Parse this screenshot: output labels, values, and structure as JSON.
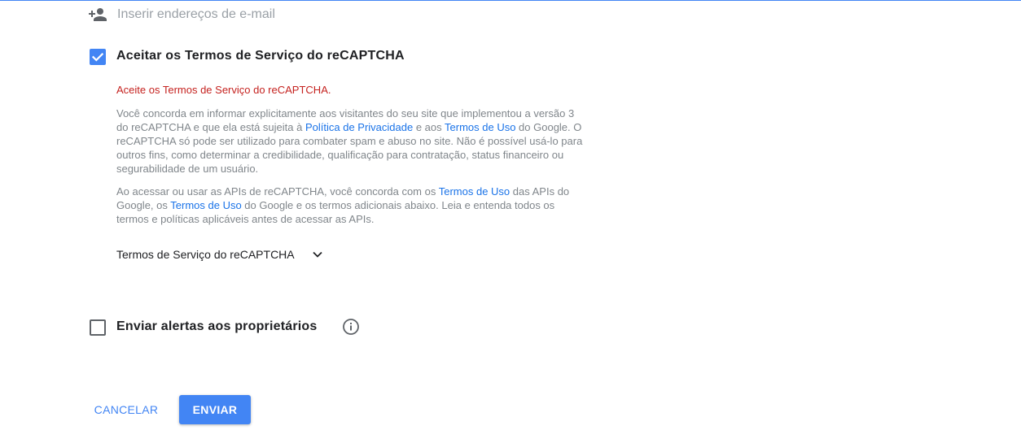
{
  "email": {
    "placeholder": "Inserir endereços de e-mail",
    "icon": "person-add-icon"
  },
  "accept_tos": {
    "label": "Aceitar os Termos de Serviço do reCAPTCHA",
    "checked": true,
    "error": "Aceite os Termos de Serviço do reCAPTCHA.",
    "paragraph1": {
      "t1": "Você concorda em informar explicitamente aos visitantes do seu site que implementou a versão 3 do reCAPTCHA e que ela está sujeita à ",
      "link_privacy": "Política de Privacidade",
      "t2": " e aos ",
      "link_terms": "Termos de Uso",
      "t3": " do Google. O reCAPTCHA só pode ser utilizado para combater spam e abuso no site. Não é possível usá-lo para outros fins, como determinar a credibilidade, qualificação para contratação, status financeiro ou segurabilidade de um usuário."
    },
    "paragraph2": {
      "t1": "Ao acessar ou usar as APIs de reCAPTCHA, você concorda com os ",
      "link_terms_api": "Termos de Uso",
      "t2": " das APIs do Google, os ",
      "link_terms_google": "Termos de Uso",
      "t3": " do Google e os termos adicionais abaixo. Leia e entenda todos os termos e políticas aplicáveis antes de acessar as APIs."
    },
    "tos_toggle_label": "Termos de Serviço do reCAPTCHA",
    "tos_toggle_icon": "chevron-down-icon"
  },
  "alerts": {
    "label": "Enviar alertas aos proprietários",
    "checked": false,
    "info_icon": "info-icon"
  },
  "buttons": {
    "cancel": "CANCELAR",
    "send": "ENVIAR"
  },
  "colors": {
    "accent": "#4285f4",
    "error": "#c5221f",
    "link": "#1a73e8",
    "muted_text": "#80868b"
  }
}
